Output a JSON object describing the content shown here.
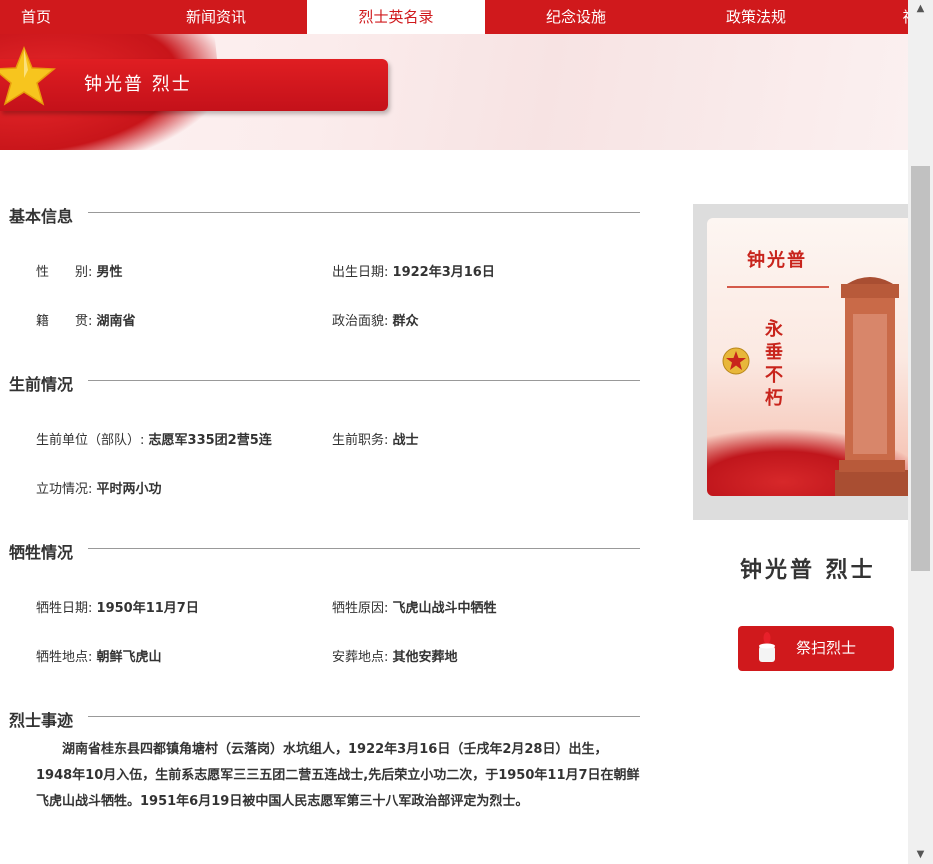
{
  "nav": {
    "items": [
      {
        "label": "首页"
      },
      {
        "label": "新闻资讯"
      },
      {
        "label": "烈士英名录"
      },
      {
        "label": "纪念设施"
      },
      {
        "label": "政策法规"
      },
      {
        "label": "祠"
      }
    ],
    "active_index": 2
  },
  "banner": {
    "name_title": "钟光普 烈士"
  },
  "sections": {
    "basic": {
      "title": "基本信息",
      "gender_label": "性　　别:",
      "gender": "男性",
      "birth_label": "出生日期:",
      "birth": "1922年3月16日",
      "origin_label": "籍　　贯:",
      "origin": "湖南省",
      "political_label": "政治面貌:",
      "political": "群众"
    },
    "life": {
      "title": "生前情况",
      "unit_label": "生前单位（部队）:",
      "unit": "志愿军335团2营5连",
      "duty_label": "生前职务:",
      "duty": "战士",
      "merit_label": "立功情况:",
      "merit": "平时两小功"
    },
    "sacrifice": {
      "title": "牺牲情况",
      "date_label": "牺牲日期:",
      "date": "1950年11月7日",
      "reason_label": "牺牲原因:",
      "reason": "飞虎山战斗中牺牲",
      "place_label": "牺牲地点:",
      "place": "朝鲜飞虎山",
      "burial_label": "安葬地点:",
      "burial": "其他安葬地"
    },
    "story": {
      "title": "烈士事迹",
      "text": "湖南省桂东县四都镇角塘村（云落岗）水坑组人，1922年3月16日（壬戌年2月28日）出生，1948年10月入伍，生前系志愿军三三五团二营五连战士,先后荣立小功二次，于1950年11月7日在朝鲜飞虎山战斗牺牲。1951年6月19日被中国人民志愿军第三十八军政治部评定为烈士。"
    }
  },
  "profile": {
    "photo_name": "钟光普",
    "photo_slogan": "永垂不朽",
    "hero_name": "钟光普 烈士",
    "mourn_button": "祭扫烈士"
  },
  "colors": {
    "accent": "#d0191c",
    "text": "#333333"
  },
  "icons": {
    "star": "star-icon",
    "candle": "candle-icon",
    "emblem": "army-emblem-icon"
  }
}
